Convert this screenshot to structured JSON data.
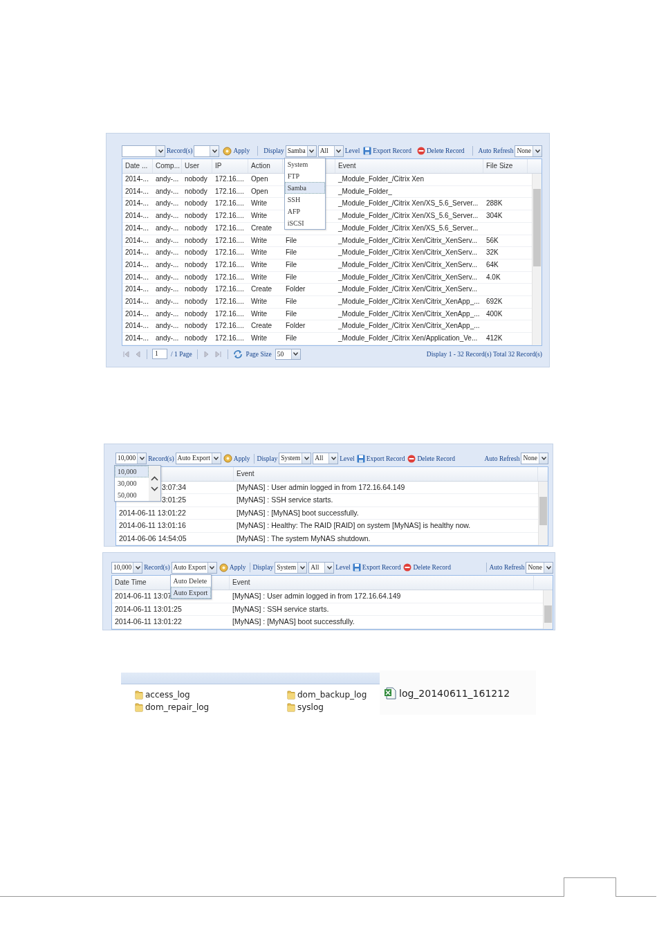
{
  "screenshots": [
    {
      "kind": "log_grid",
      "toolbar": [
        {
          "kind": "select"
        },
        {
          "kind": "label",
          "text": "Record(s)"
        },
        {
          "kind": "select"
        },
        {
          "kind": "apply",
          "label": "Apply"
        },
        {
          "kind": "separator"
        },
        {
          "kind": "label",
          "text": "Display"
        },
        {
          "kind": "select",
          "value": "Samba",
          "dropdown": {
            "kind": "list",
            "items": [
              {
                "label": "System",
                "selected": false
              },
              {
                "label": "FTP",
                "selected": false
              },
              {
                "label": "Samba",
                "selected": true
              },
              {
                "label": "SSH",
                "selected": false
              },
              {
                "label": "AFP",
                "selected": false
              },
              {
                "label": "iSCSI",
                "selected": false
              }
            ]
          }
        },
        {
          "kind": "select",
          "value": "All"
        },
        {
          "kind": "label",
          "text": "Level"
        },
        {
          "kind": "export",
          "label": "Export Record"
        },
        {
          "kind": "delete",
          "label": "Delete Record"
        },
        {
          "kind": "separator"
        },
        {
          "kind": "label",
          "text": "Auto Refresh"
        },
        {
          "kind": "select",
          "value": "None"
        }
      ],
      "columns": [
        {
          "label": "Date ..."
        },
        {
          "label": "Comp..."
        },
        {
          "label": "User"
        },
        {
          "label": "IP"
        },
        {
          "label": "Action"
        },
        {},
        {
          "label": "Event"
        },
        {
          "label": "File Size"
        }
      ],
      "rows": [
        {
          "cells": [
            "2014-...",
            "andy-...",
            "nobody",
            "172.16....",
            "Open",
            null,
            "_Module_Folder_/Citrix Xen",
            null
          ]
        },
        {
          "cells": [
            "2014-...",
            "andy-...",
            "nobody",
            "172.16....",
            "Open",
            null,
            "_Module_Folder_",
            null
          ]
        },
        {
          "cells": [
            "2014-...",
            "andy-...",
            "nobody",
            "172.16....",
            "Write",
            null,
            "_Module_Folder_/Citrix Xen/XS_5.6_Server...",
            "288K"
          ]
        },
        {
          "cells": [
            "2014-...",
            "andy-...",
            "nobody",
            "172.16....",
            "Write",
            null,
            "_Module_Folder_/Citrix Xen/XS_5.6_Server...",
            "304K"
          ]
        },
        {
          "cells": [
            "2014-...",
            "andy-...",
            "nobody",
            "172.16....",
            "Create",
            null,
            "_Module_Folder_/Citrix Xen/XS_5.6_Server...",
            null
          ]
        },
        {
          "cells": [
            "2014-...",
            "andy-...",
            "nobody",
            "172.16....",
            "Write",
            "File",
            "_Module_Folder_/Citrix Xen/Citrix_XenServ...",
            "56K"
          ]
        },
        {
          "cells": [
            "2014-...",
            "andy-...",
            "nobody",
            "172.16....",
            "Write",
            "File",
            "_Module_Folder_/Citrix Xen/Citrix_XenServ...",
            "32K"
          ]
        },
        {
          "cells": [
            "2014-...",
            "andy-...",
            "nobody",
            "172.16....",
            "Write",
            "File",
            "_Module_Folder_/Citrix Xen/Citrix_XenServ...",
            "64K"
          ]
        },
        {
          "cells": [
            "2014-...",
            "andy-...",
            "nobody",
            "172.16....",
            "Write",
            "File",
            "_Module_Folder_/Citrix Xen/Citrix_XenServ...",
            "4.0K"
          ]
        },
        {
          "cells": [
            "2014-...",
            "andy-...",
            "nobody",
            "172.16....",
            "Create",
            "Folder",
            "_Module_Folder_/Citrix Xen/Citrix_XenServ...",
            null
          ]
        },
        {
          "cells": [
            "2014-...",
            "andy-...",
            "nobody",
            "172.16....",
            "Write",
            "File",
            "_Module_Folder_/Citrix Xen/Citrix_XenApp_...",
            "692K"
          ]
        },
        {
          "cells": [
            "2014-...",
            "andy-...",
            "nobody",
            "172.16....",
            "Write",
            "File",
            "_Module_Folder_/Citrix Xen/Citrix_XenApp_...",
            "400K"
          ]
        },
        {
          "cells": [
            "2014-...",
            "andy-...",
            "nobody",
            "172.16....",
            "Create",
            "Folder",
            "_Module_Folder_/Citrix Xen/Citrix_XenApp_...",
            null
          ]
        },
        {
          "cells": [
            "2014-...",
            "andy-...",
            "nobody",
            "172.16....",
            "Write",
            "File",
            "_Module_Folder_/Citrix Xen/Application_Ve...",
            "412K"
          ]
        }
      ],
      "pager": {
        "page": "1",
        "page_label": "/ 1 Page",
        "page_size_label": "Page Size",
        "page_size": "50",
        "summary": "Display 1 - 32 Record(s) Total 32 Record(s)"
      }
    },
    {
      "kind": "log_grid",
      "toolbar": [
        {
          "kind": "select",
          "value": "10,000",
          "dropdown": {
            "kind": "scroll_list",
            "items": [
              {
                "label": "10,000",
                "selected": true
              },
              {
                "label": "30,000",
                "selected": false
              },
              {
                "label": "50,000",
                "selected": false
              }
            ]
          }
        },
        {
          "kind": "label",
          "text": "Record(s)"
        },
        {
          "kind": "select",
          "value": "Auto Export"
        },
        {
          "kind": "apply",
          "label": "Apply"
        },
        {
          "kind": "separator"
        },
        {
          "kind": "label",
          "text": "Display"
        },
        {
          "kind": "select",
          "value": "System"
        },
        {
          "kind": "select",
          "value": "All"
        },
        {
          "kind": "label",
          "text": "Level"
        },
        {
          "kind": "export",
          "label": "Export Record"
        },
        {
          "kind": "delete",
          "label": "Delete Record"
        },
        {
          "kind": "spacer"
        },
        {
          "kind": "label",
          "text": "Auto Refresh"
        },
        {
          "kind": "select",
          "value": "None"
        }
      ],
      "columns": [
        {},
        {
          "label": "Event"
        }
      ],
      "rows": [
        {
          "kind": "partial",
          "cells": [
            "3:07:34",
            "[MyNAS] : User admin logged in from 172.16.64.149"
          ]
        },
        {
          "kind": "partial",
          "cells": [
            "3:01:25",
            "[MyNAS] : SSH service starts."
          ]
        },
        {
          "kind": "full",
          "cells": [
            "2014-06-11 13:01:22",
            "[MyNAS] : [MyNAS] boot successfully."
          ]
        },
        {
          "kind": "full",
          "cells": [
            "2014-06-11 13:01:16",
            "[MyNAS] : Healthy: The RAID [RAID] on system [MyNAS] is healthy now."
          ]
        },
        {
          "kind": "full",
          "cells": [
            "2014-06-06 14:54:05",
            "[MyNAS] : The system MyNAS shutdown."
          ]
        }
      ]
    },
    {
      "kind": "log_grid",
      "toolbar": [
        {
          "kind": "select",
          "value": "10,000"
        },
        {
          "kind": "label",
          "text": "Record(s)"
        },
        {
          "kind": "select",
          "value": "Auto Export",
          "dropdown": {
            "kind": "list",
            "items": [
              {
                "label": "Auto Delete",
                "selected": false
              },
              {
                "label": "Auto Export",
                "selected": true
              }
            ]
          }
        },
        {
          "kind": "apply",
          "label": "Apply"
        },
        {
          "kind": "separator"
        },
        {
          "kind": "label",
          "text": "Display"
        },
        {
          "kind": "select",
          "value": "System"
        },
        {
          "kind": "select",
          "value": "All"
        },
        {
          "kind": "label",
          "text": "Level"
        },
        {
          "kind": "export",
          "label": "Export Record"
        },
        {
          "kind": "delete",
          "label": "Delete Record"
        },
        {
          "kind": "spacer"
        },
        {
          "kind": "separator"
        },
        {
          "kind": "label",
          "text": "Auto Refresh"
        },
        {
          "kind": "select",
          "value": "None"
        }
      ],
      "columns": [
        {
          "label": "Date Time"
        },
        {
          "label": "Event"
        }
      ],
      "rows": [
        {
          "cells": [
            "2014-06-11 13:07",
            "[MyNAS] : User admin logged in from 172.16.64.149"
          ]
        },
        {
          "cells": [
            "2014-06-11 13:01:25",
            "[MyNAS] : SSH service starts."
          ]
        },
        {
          "cells": [
            "2014-06-11 13:01:22",
            "[MyNAS] : [MyNAS] boot successfully."
          ]
        }
      ]
    },
    {
      "kind": "file_browser",
      "folders": [
        "access_log",
        "dom_backup_log",
        "dom_repair_log",
        "syslog"
      ],
      "file": "log_20140611_161212"
    }
  ]
}
